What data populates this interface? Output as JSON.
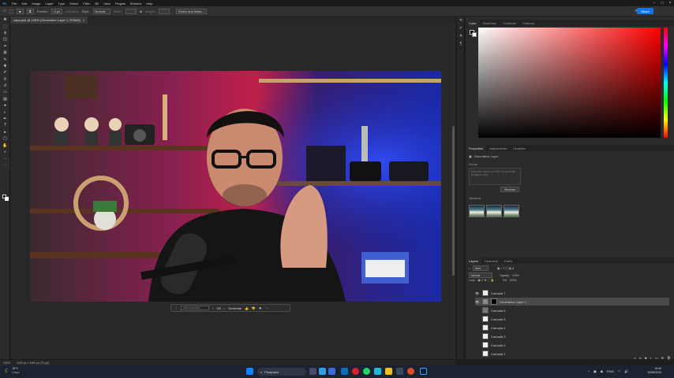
{
  "app": {
    "logo": "Ps"
  },
  "menu": [
    "File",
    "Edit",
    "Image",
    "Layer",
    "Type",
    "Select",
    "Filter",
    "3D",
    "View",
    "Plugins",
    "Window",
    "Help"
  ],
  "options": {
    "feather_label": "Feather:",
    "feather_value": "0 px",
    "antialias": "Anti-alias",
    "style_label": "Style:",
    "style_value": "Normal",
    "width_label": "Width:",
    "height_label": "Height:",
    "select_mask": "Select and Mask...",
    "share": "Share"
  },
  "document_tab": {
    "title": "capa.psd @ 100% (Generative Layer 1, RGB/8)",
    "close": "×"
  },
  "statusbar": {
    "zoom": "100%",
    "info": "1920 px x 1080 px (72 ppi)"
  },
  "contextbar": {
    "prompt_placeholder": "Add a prompt",
    "page": "3/3",
    "generate": "Generate"
  },
  "color_panel": {
    "tabs": [
      "Color",
      "Swatches",
      "Gradients",
      "Patterns"
    ],
    "active": "Color"
  },
  "properties_panel": {
    "tabs": [
      "Properties",
      "Adjustments",
      "Libraries"
    ],
    "active": "Properties",
    "layer_type": "Generative Layer",
    "prompt_label": "Prompt",
    "prompt_placeholder": "Describe what you'd like to generate (English only)",
    "generate_label": "Generate",
    "variations_label": "Variations"
  },
  "layers_panel": {
    "tabs": [
      "Layers",
      "Channels",
      "Paths"
    ],
    "active": "Layers",
    "kind": "Kind",
    "blend_mode": "Normal",
    "opacity_label": "Opacity:",
    "opacity": "100%",
    "lock_label": "Lock:",
    "fill_label": "Fill:",
    "fill": "100%",
    "layers": [
      {
        "name": "Camada 7",
        "selected": false
      },
      {
        "name": "Generative Layer 1",
        "selected": true
      },
      {
        "name": "Camada 6",
        "selected": false
      },
      {
        "name": "Camada 5",
        "selected": false
      },
      {
        "name": "Camada 4",
        "selected": false
      },
      {
        "name": "Camada 3",
        "selected": false
      },
      {
        "name": "Camada 2",
        "selected": false
      },
      {
        "name": "Camada 1",
        "selected": false
      }
    ]
  },
  "taskbar": {
    "weather_temp": "15°C",
    "weather_desc": "Limpo",
    "search_placeholder": "Pesquisar",
    "lang": "ENG",
    "time": "19:44",
    "date": "20/06/2023"
  },
  "colors": {
    "accent": "#1473e6",
    "ps_blue": "#31a8ff"
  }
}
